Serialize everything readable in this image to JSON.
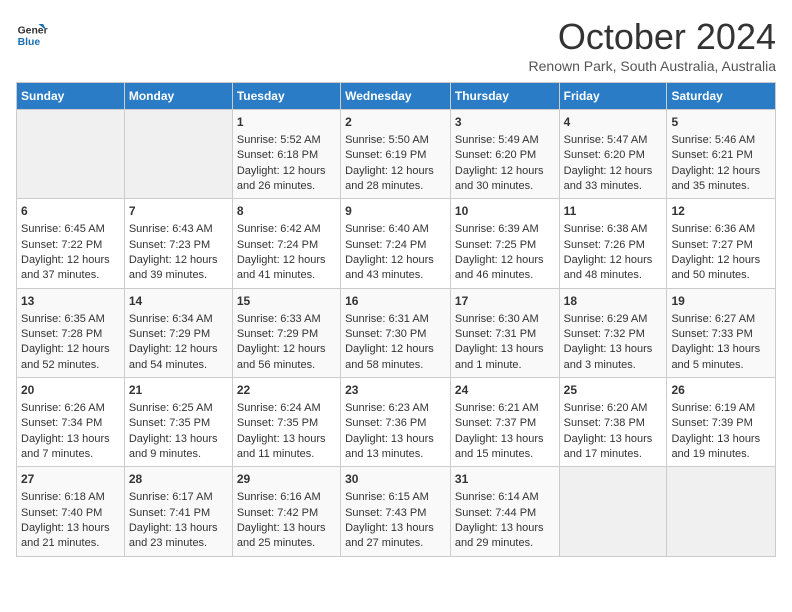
{
  "logo": {
    "line1": "General",
    "line2": "Blue"
  },
  "title": "October 2024",
  "subtitle": "Renown Park, South Australia, Australia",
  "headers": [
    "Sunday",
    "Monday",
    "Tuesday",
    "Wednesday",
    "Thursday",
    "Friday",
    "Saturday"
  ],
  "weeks": [
    [
      {
        "day": "",
        "sunrise": "",
        "sunset": "",
        "daylight": ""
      },
      {
        "day": "",
        "sunrise": "",
        "sunset": "",
        "daylight": ""
      },
      {
        "day": "1",
        "sunrise": "Sunrise: 5:52 AM",
        "sunset": "Sunset: 6:18 PM",
        "daylight": "Daylight: 12 hours and 26 minutes."
      },
      {
        "day": "2",
        "sunrise": "Sunrise: 5:50 AM",
        "sunset": "Sunset: 6:19 PM",
        "daylight": "Daylight: 12 hours and 28 minutes."
      },
      {
        "day": "3",
        "sunrise": "Sunrise: 5:49 AM",
        "sunset": "Sunset: 6:20 PM",
        "daylight": "Daylight: 12 hours and 30 minutes."
      },
      {
        "day": "4",
        "sunrise": "Sunrise: 5:47 AM",
        "sunset": "Sunset: 6:20 PM",
        "daylight": "Daylight: 12 hours and 33 minutes."
      },
      {
        "day": "5",
        "sunrise": "Sunrise: 5:46 AM",
        "sunset": "Sunset: 6:21 PM",
        "daylight": "Daylight: 12 hours and 35 minutes."
      }
    ],
    [
      {
        "day": "6",
        "sunrise": "Sunrise: 6:45 AM",
        "sunset": "Sunset: 7:22 PM",
        "daylight": "Daylight: 12 hours and 37 minutes."
      },
      {
        "day": "7",
        "sunrise": "Sunrise: 6:43 AM",
        "sunset": "Sunset: 7:23 PM",
        "daylight": "Daylight: 12 hours and 39 minutes."
      },
      {
        "day": "8",
        "sunrise": "Sunrise: 6:42 AM",
        "sunset": "Sunset: 7:24 PM",
        "daylight": "Daylight: 12 hours and 41 minutes."
      },
      {
        "day": "9",
        "sunrise": "Sunrise: 6:40 AM",
        "sunset": "Sunset: 7:24 PM",
        "daylight": "Daylight: 12 hours and 43 minutes."
      },
      {
        "day": "10",
        "sunrise": "Sunrise: 6:39 AM",
        "sunset": "Sunset: 7:25 PM",
        "daylight": "Daylight: 12 hours and 46 minutes."
      },
      {
        "day": "11",
        "sunrise": "Sunrise: 6:38 AM",
        "sunset": "Sunset: 7:26 PM",
        "daylight": "Daylight: 12 hours and 48 minutes."
      },
      {
        "day": "12",
        "sunrise": "Sunrise: 6:36 AM",
        "sunset": "Sunset: 7:27 PM",
        "daylight": "Daylight: 12 hours and 50 minutes."
      }
    ],
    [
      {
        "day": "13",
        "sunrise": "Sunrise: 6:35 AM",
        "sunset": "Sunset: 7:28 PM",
        "daylight": "Daylight: 12 hours and 52 minutes."
      },
      {
        "day": "14",
        "sunrise": "Sunrise: 6:34 AM",
        "sunset": "Sunset: 7:29 PM",
        "daylight": "Daylight: 12 hours and 54 minutes."
      },
      {
        "day": "15",
        "sunrise": "Sunrise: 6:33 AM",
        "sunset": "Sunset: 7:29 PM",
        "daylight": "Daylight: 12 hours and 56 minutes."
      },
      {
        "day": "16",
        "sunrise": "Sunrise: 6:31 AM",
        "sunset": "Sunset: 7:30 PM",
        "daylight": "Daylight: 12 hours and 58 minutes."
      },
      {
        "day": "17",
        "sunrise": "Sunrise: 6:30 AM",
        "sunset": "Sunset: 7:31 PM",
        "daylight": "Daylight: 13 hours and 1 minute."
      },
      {
        "day": "18",
        "sunrise": "Sunrise: 6:29 AM",
        "sunset": "Sunset: 7:32 PM",
        "daylight": "Daylight: 13 hours and 3 minutes."
      },
      {
        "day": "19",
        "sunrise": "Sunrise: 6:27 AM",
        "sunset": "Sunset: 7:33 PM",
        "daylight": "Daylight: 13 hours and 5 minutes."
      }
    ],
    [
      {
        "day": "20",
        "sunrise": "Sunrise: 6:26 AM",
        "sunset": "Sunset: 7:34 PM",
        "daylight": "Daylight: 13 hours and 7 minutes."
      },
      {
        "day": "21",
        "sunrise": "Sunrise: 6:25 AM",
        "sunset": "Sunset: 7:35 PM",
        "daylight": "Daylight: 13 hours and 9 minutes."
      },
      {
        "day": "22",
        "sunrise": "Sunrise: 6:24 AM",
        "sunset": "Sunset: 7:35 PM",
        "daylight": "Daylight: 13 hours and 11 minutes."
      },
      {
        "day": "23",
        "sunrise": "Sunrise: 6:23 AM",
        "sunset": "Sunset: 7:36 PM",
        "daylight": "Daylight: 13 hours and 13 minutes."
      },
      {
        "day": "24",
        "sunrise": "Sunrise: 6:21 AM",
        "sunset": "Sunset: 7:37 PM",
        "daylight": "Daylight: 13 hours and 15 minutes."
      },
      {
        "day": "25",
        "sunrise": "Sunrise: 6:20 AM",
        "sunset": "Sunset: 7:38 PM",
        "daylight": "Daylight: 13 hours and 17 minutes."
      },
      {
        "day": "26",
        "sunrise": "Sunrise: 6:19 AM",
        "sunset": "Sunset: 7:39 PM",
        "daylight": "Daylight: 13 hours and 19 minutes."
      }
    ],
    [
      {
        "day": "27",
        "sunrise": "Sunrise: 6:18 AM",
        "sunset": "Sunset: 7:40 PM",
        "daylight": "Daylight: 13 hours and 21 minutes."
      },
      {
        "day": "28",
        "sunrise": "Sunrise: 6:17 AM",
        "sunset": "Sunset: 7:41 PM",
        "daylight": "Daylight: 13 hours and 23 minutes."
      },
      {
        "day": "29",
        "sunrise": "Sunrise: 6:16 AM",
        "sunset": "Sunset: 7:42 PM",
        "daylight": "Daylight: 13 hours and 25 minutes."
      },
      {
        "day": "30",
        "sunrise": "Sunrise: 6:15 AM",
        "sunset": "Sunset: 7:43 PM",
        "daylight": "Daylight: 13 hours and 27 minutes."
      },
      {
        "day": "31",
        "sunrise": "Sunrise: 6:14 AM",
        "sunset": "Sunset: 7:44 PM",
        "daylight": "Daylight: 13 hours and 29 minutes."
      },
      {
        "day": "",
        "sunrise": "",
        "sunset": "",
        "daylight": ""
      },
      {
        "day": "",
        "sunrise": "",
        "sunset": "",
        "daylight": ""
      }
    ]
  ]
}
